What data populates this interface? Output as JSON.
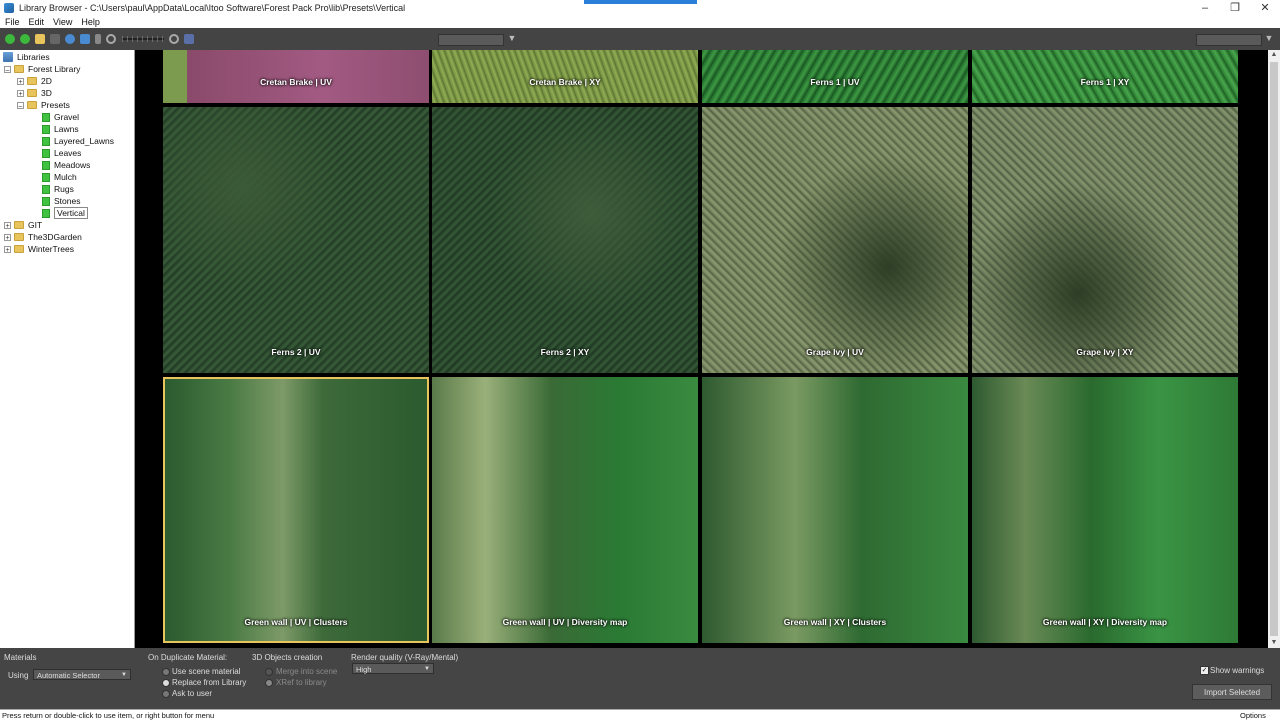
{
  "window": {
    "title": "Library Browser - C:\\Users\\paul\\AppData\\Local\\Itoo Software\\Forest Pack Pro\\lib\\Presets\\Vertical",
    "accent": "#2a7fd8"
  },
  "menu": [
    "File",
    "Edit",
    "View",
    "Help"
  ],
  "tree": {
    "root": "Libraries",
    "forest_library": "Forest Library",
    "folder_2d": "2D",
    "folder_3d": "3D",
    "presets": "Presets",
    "preset_items": [
      "Gravel",
      "Lawns",
      "Layered_Lawns",
      "Leaves",
      "Meadows",
      "Mulch",
      "Rugs",
      "Stones",
      "Vertical"
    ],
    "other_libraries": [
      "GIT",
      "The3DGarden",
      "WinterTrees"
    ]
  },
  "tiles": {
    "row0": [
      "Cretan Brake | UV",
      "Cretan Brake | XY",
      "Ferns 1 | UV",
      "Ferns 1 | XY"
    ],
    "row1": [
      "Ferns 2 | UV",
      "Ferns 2 | XY",
      "Grape Ivy | UV",
      "Grape Ivy | XY"
    ],
    "row2": [
      "Green wall | UV | Clusters",
      "Green wall | UV | Diversity map",
      "Green wall | XY | Clusters",
      "Green wall | XY | Diversity map"
    ],
    "selected": "Green wall | UV | Clusters",
    "selection_color": "#e8c45c"
  },
  "bottom": {
    "materials_label": "Materials",
    "using_label": "Using",
    "using_value": "Automatic Selector",
    "on_duplicate_label": "On Duplicate Material:",
    "dup_options": [
      "Use scene material",
      "Replace from Library",
      "Ask to user"
    ],
    "dup_selected": "Replace from Library",
    "objects_label": "3D Objects creation",
    "obj_options": [
      "Merge into scene",
      "XRef to library"
    ],
    "obj_selected": "XRef to library",
    "render_quality_label": "Render quality (V-Ray/Mental)",
    "render_quality_value": "High",
    "show_warnings_label": "Show warnings",
    "show_warnings_checked": true,
    "import_label": "Import Selected"
  },
  "status": {
    "message": "Press return or double-click to use item, or right button for menu",
    "options_label": "Options"
  }
}
